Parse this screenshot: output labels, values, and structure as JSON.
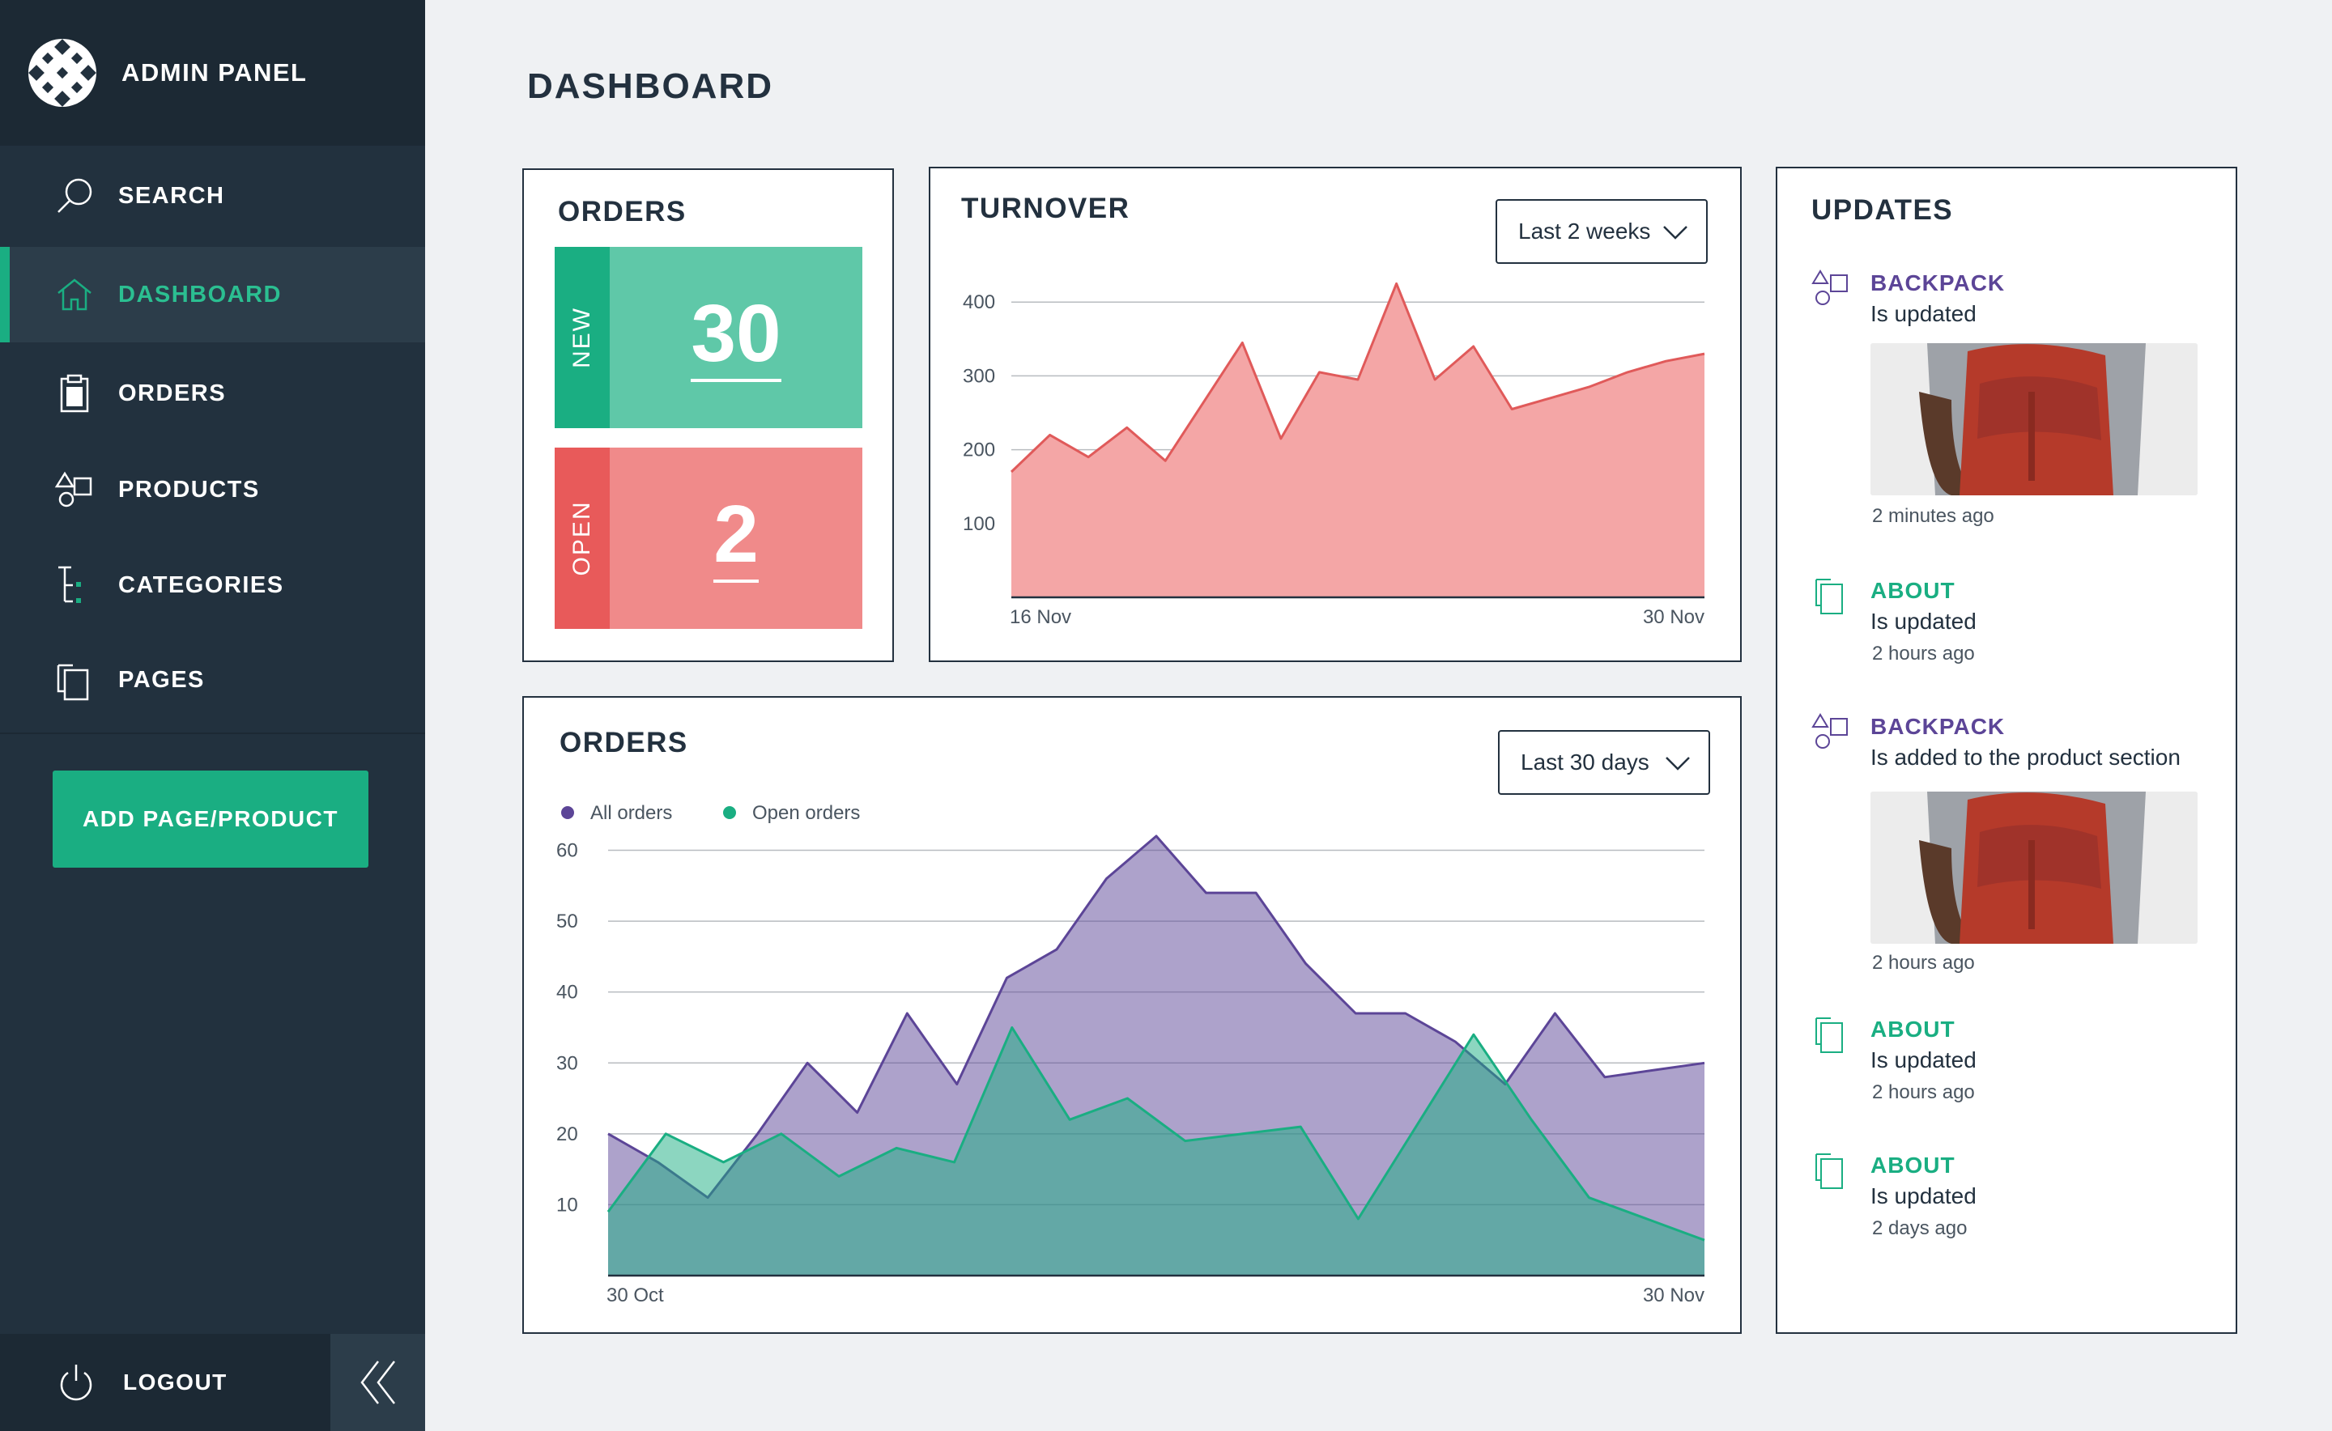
{
  "sidebar": {
    "brand": "ADMIN PANEL",
    "items": [
      {
        "label": "SEARCH",
        "icon": "search-icon"
      },
      {
        "label": "DASHBOARD",
        "icon": "home-icon"
      },
      {
        "label": "ORDERS",
        "icon": "clipboard-icon"
      },
      {
        "label": "PRODUCTS",
        "icon": "shapes-icon"
      },
      {
        "label": "CATEGORIES",
        "icon": "tree-icon"
      },
      {
        "label": "PAGES",
        "icon": "pages-icon"
      }
    ],
    "active_item": "DASHBOARD",
    "add_button": "ADD PAGE/PRODUCT",
    "logout": "LOGOUT"
  },
  "page_title": "DASHBOARD",
  "orders_card": {
    "title": "ORDERS",
    "new_label": "NEW",
    "new_value": "30",
    "open_label": "OPEN",
    "open_value": "2"
  },
  "turnover": {
    "title": "TURNOVER",
    "range": "Last 2 weeks"
  },
  "orders_chart": {
    "title": "ORDERS",
    "range": "Last 30 days"
  },
  "updates": {
    "title": "UPDATES",
    "items": [
      {
        "title": "BACKPACK",
        "desc": "Is updated",
        "time": "2 minutes ago",
        "kind": "product"
      },
      {
        "title": "ABOUT",
        "desc": "Is updated",
        "time": "2 hours ago",
        "kind": "page"
      },
      {
        "title": "BACKPACK",
        "desc": "Is added to the product section",
        "time": "2 hours ago",
        "kind": "product"
      },
      {
        "title": "ABOUT",
        "desc": "Is updated",
        "time": "2 hours ago",
        "kind": "page"
      },
      {
        "title": "ABOUT",
        "desc": "Is updated",
        "time": "2 days ago",
        "kind": "page"
      }
    ]
  },
  "colors": {
    "sidebar_bg": "#22313e",
    "accent_green": "#1aae82",
    "stat_green": "#5fc8a8",
    "stat_red": "#f08a8a",
    "turnover_fill": "#f4a6a6",
    "turnover_line": "#e05a5a",
    "all_orders": "#5c4597",
    "open_orders": "#1aae82",
    "product_title": "#5c4597",
    "page_title": "#1aae82"
  },
  "chart_data": [
    {
      "type": "area",
      "title": "TURNOVER",
      "x_labels": [
        "16 Nov",
        "30 Nov"
      ],
      "yticks": [
        100,
        200,
        300,
        400
      ],
      "ylim": [
        0,
        420
      ],
      "grid": true,
      "series": [
        {
          "values": [
            170,
            220,
            190,
            230,
            185,
            265,
            345,
            215,
            305,
            295,
            425,
            295,
            340,
            255,
            270,
            285,
            305,
            320,
            330
          ]
        }
      ]
    },
    {
      "type": "area",
      "title": "ORDERS",
      "x_labels": [
        "30 Oct",
        "30 Nov"
      ],
      "yticks": [
        10,
        20,
        30,
        40,
        50,
        60
      ],
      "ylim": [
        0,
        62
      ],
      "grid": true,
      "legend": "top-left",
      "series": [
        {
          "name": "All orders",
          "values": [
            20,
            16,
            11,
            20,
            30,
            23,
            37,
            27,
            42,
            46,
            56,
            62,
            54,
            54,
            44,
            37,
            37,
            33,
            27,
            37,
            28,
            29,
            30
          ]
        },
        {
          "name": "Open orders",
          "values": [
            9,
            20,
            16,
            20,
            14,
            18,
            16,
            35,
            22,
            25,
            19,
            20,
            21,
            8,
            21,
            34,
            22,
            11,
            8,
            5
          ]
        }
      ]
    }
  ]
}
